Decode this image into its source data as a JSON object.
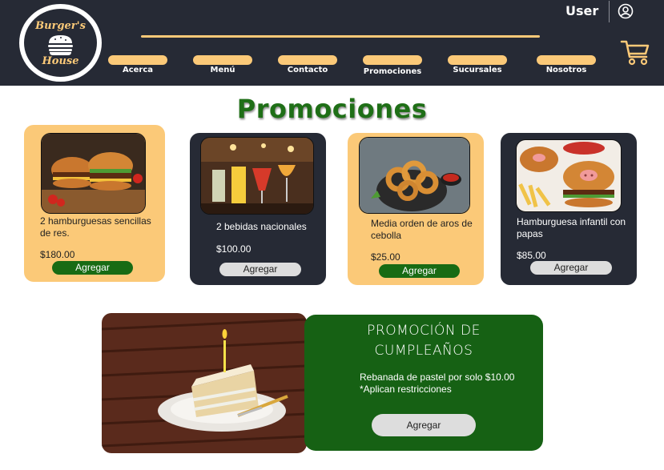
{
  "header": {
    "logo": {
      "top_text": "Burger's",
      "bottom_text": "House"
    },
    "user_label": "User",
    "nav": [
      {
        "label": "Acerca"
      },
      {
        "label": "Menú"
      },
      {
        "label": "Contacto"
      },
      {
        "label": "Promociones"
      },
      {
        "label": "Sucursales"
      },
      {
        "label": "Nosotros"
      }
    ]
  },
  "page_title": "Promociones",
  "products": [
    {
      "description": "2 hamburguesas sencillas de res.",
      "price": "$180.00",
      "button": "Agregar",
      "theme": "light",
      "image": "burgers-photo"
    },
    {
      "description": "2 bebidas nacionales",
      "price": "$100.00",
      "button": "Agregar",
      "theme": "dark",
      "image": "drinks-photo"
    },
    {
      "description": "Media orden de aros de cebolla",
      "price": "$25.00",
      "button": "Agregar",
      "theme": "light",
      "image": "onion-rings-photo"
    },
    {
      "description": "Hamburguesa infantil con papas",
      "price": "$85.00",
      "button": "Agregar",
      "theme": "dark",
      "image": "kids-burger-photo"
    }
  ],
  "birthday_promo": {
    "title_line1": "PROMOCIÓN DE",
    "title_line2": "CUMPLEAÑOS",
    "line1": "Rebanada de pastel por solo $10.00",
    "line2": "*Aplican restricciones",
    "button": "Agregar",
    "image": "cake-photo"
  },
  "colors": {
    "header_bg": "#262a35",
    "accent": "#fbc978",
    "green": "#186b14",
    "title_green": "#1f6f17"
  }
}
